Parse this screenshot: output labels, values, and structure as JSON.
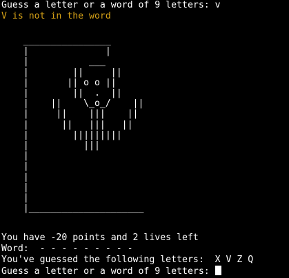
{
  "terminal": {
    "prompt_line_1": "Guess a letter or a word of 9 letters: v",
    "message": "V is not in the word",
    "gallows_art": "    ________________\n    |              |\n    |           ___\n    |        ||     ||\n    |       || o o ||\n    |        ||  .  ||\n    |    ||    \\_o_/    ||\n    |     ||    |||    ||\n    |      ||   |||   ||\n    |        |||||||||\n    |          |||\n    |\n    |\n    |\n    |\n    |\n    |_____________________",
    "status_line": "You have -20 points and 2 lives left",
    "word_line": "Word:  - - - - - - - - -",
    "guessed_line": "You've guessed the following letters:  X V Z Q",
    "prompt_line_2": "Guess a letter or a word of 9 letters: "
  },
  "colors": {
    "background": "#000000",
    "text": "#ffffff",
    "message": "#d4a017",
    "figure": "#ff99ff"
  }
}
